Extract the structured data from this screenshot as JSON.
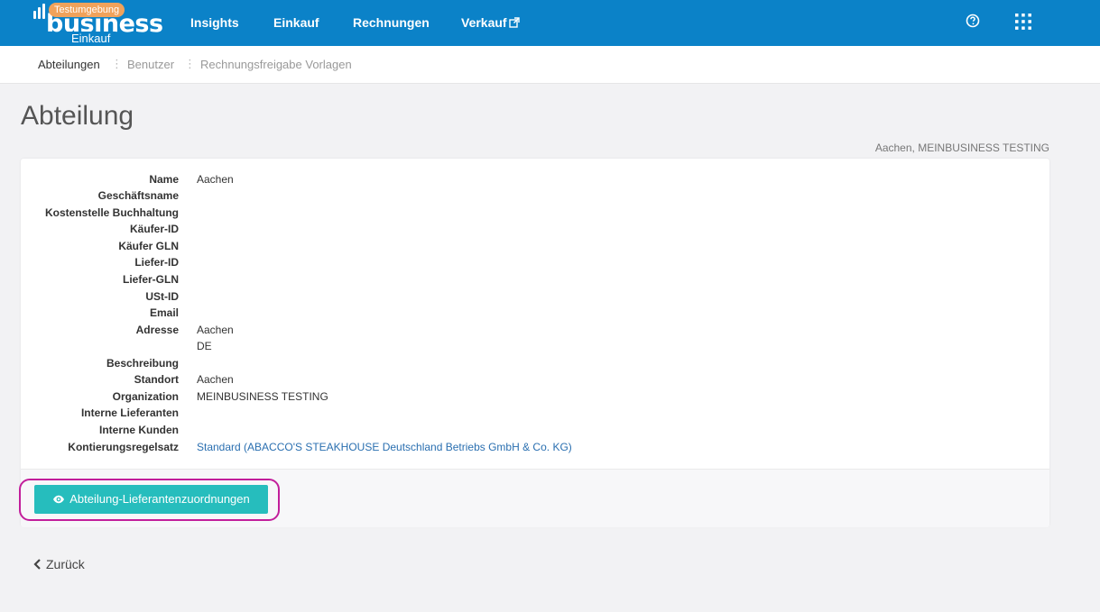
{
  "topbar": {
    "logo_word": "business",
    "logo_badge": "Testumgebung",
    "logo_sub": "Einkauf",
    "nav": [
      "Insights",
      "Einkauf",
      "Rechnungen",
      "Verkauf"
    ],
    "help_icon": "question-circle-icon",
    "apps_icon": "grid-icon",
    "colors": {
      "bar": "#0b82c8",
      "badge": "#f0a25b"
    }
  },
  "subnav": {
    "items": [
      "Abteilungen",
      "Benutzer",
      "Rechnungsfreigabe Vorlagen"
    ],
    "active": "Abteilungen"
  },
  "page": {
    "title": "Abteilung",
    "context": "Aachen, MEINBUSINESS TESTING"
  },
  "details": {
    "name": {
      "label": "Name",
      "value": "Aachen"
    },
    "business_name": {
      "label": "Geschäftsname",
      "value": ""
    },
    "cost_center": {
      "label": "Kostenstelle Buchhaltung",
      "value": ""
    },
    "buyer_id": {
      "label": "Käufer-ID",
      "value": ""
    },
    "buyer_gln": {
      "label": "Käufer GLN",
      "value": ""
    },
    "delivery_id": {
      "label": "Liefer-ID",
      "value": ""
    },
    "delivery_gln": {
      "label": "Liefer-GLN",
      "value": ""
    },
    "vat_id": {
      "label": "USt-ID",
      "value": ""
    },
    "email": {
      "label": "Email",
      "value": ""
    },
    "address": {
      "label": "Adresse",
      "line1": "Aachen",
      "line2": "DE"
    },
    "description": {
      "label": "Beschreibung",
      "value": ""
    },
    "location": {
      "label": "Standort",
      "value": "Aachen"
    },
    "organization": {
      "label": "Organization",
      "value": "MEINBUSINESS TESTING"
    },
    "internal_suppliers": {
      "label": "Interne Lieferanten",
      "value": ""
    },
    "internal_customers": {
      "label": "Interne Kunden",
      "value": ""
    },
    "account_rules": {
      "label": "Kontierungsregelsatz",
      "value": "Standard (ABACCO'S STEAKHOUSE Deutschland Betriebs GmbH & Co. KG)"
    }
  },
  "actions": {
    "supplier_mapping_button": "Abteilung-Lieferantenzuordnungen",
    "button_icon": "eye-icon",
    "button_color": "#26bdbd",
    "highlight_color": "#c21e9b"
  },
  "footer": {
    "back_label": "Zurück",
    "back_icon": "chevron-left-icon"
  }
}
